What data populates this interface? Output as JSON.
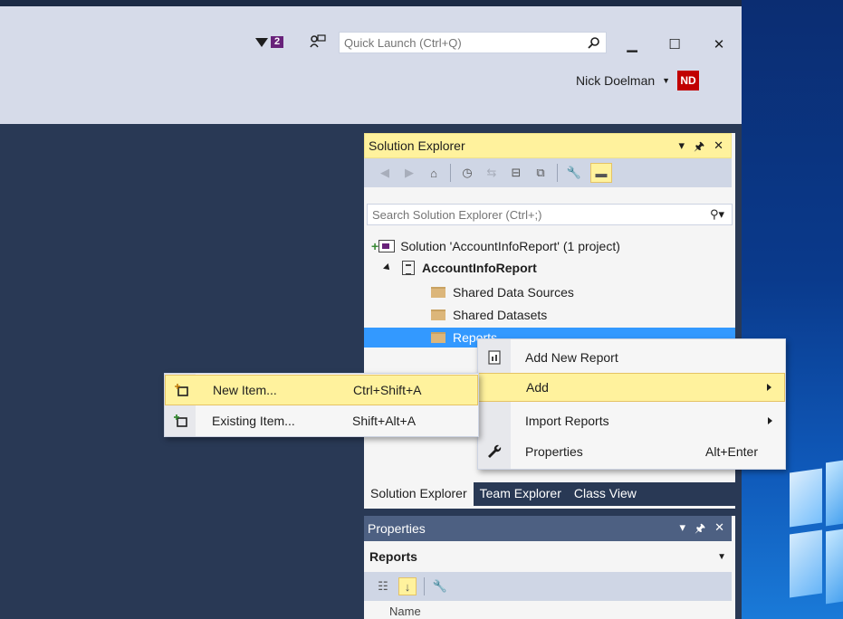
{
  "titlebar": {
    "notification_count": "2",
    "quick_launch_placeholder": "Quick Launch (Ctrl+Q)",
    "user_name": "Nick Doelman",
    "user_initials": "ND",
    "minimize": "▁",
    "maximize": "☐",
    "close": "✕"
  },
  "solution_explorer": {
    "title": "Solution Explorer",
    "search_placeholder": "Search Solution Explorer (Ctrl+;)",
    "tree": {
      "solution": "Solution 'AccountInfoReport' (1 project)",
      "project": "AccountInfoReport",
      "folders": [
        "Shared Data Sources",
        "Shared Datasets",
        "Reports"
      ]
    },
    "tabs": [
      "Solution Explorer",
      "Team Explorer",
      "Class View"
    ]
  },
  "properties": {
    "title": "Properties",
    "object": "Reports",
    "first_row": "Name"
  },
  "context_menu": {
    "items": [
      {
        "label": "Add New Report",
        "shortcut": "",
        "icon": "report-icon"
      },
      {
        "label": "Add",
        "shortcut": "",
        "icon": ""
      },
      {
        "label": "Import Reports",
        "shortcut": "",
        "icon": ""
      },
      {
        "label": "Properties",
        "shortcut": "Alt+Enter",
        "icon": "wrench-icon"
      }
    ]
  },
  "add_submenu": {
    "items": [
      {
        "label": "New Item...",
        "shortcut": "Ctrl+Shift+A",
        "icon": "new-item-icon"
      },
      {
        "label": "Existing Item...",
        "shortcut": "Shift+Alt+A",
        "icon": "existing-item-icon"
      }
    ]
  },
  "colors": {
    "vs_dark": "#293955",
    "highlight_yellow": "#fff29d",
    "selection_blue": "#3399ff",
    "avatar_red": "#c10000",
    "badge_purple": "#68217a"
  }
}
